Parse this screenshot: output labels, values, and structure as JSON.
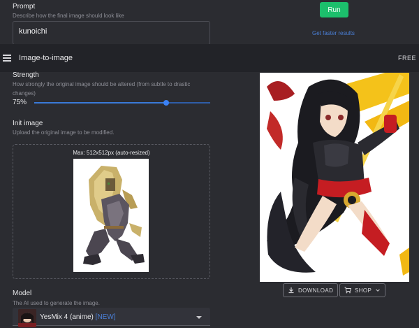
{
  "prompt": {
    "label": "Prompt",
    "description": "Describe how the final image should look like",
    "value": "kunoichi"
  },
  "run_button": {
    "label": "Run"
  },
  "faster_link": "Get faster results",
  "appbar": {
    "title": "Image-to-image",
    "plan": "FREE",
    "menu_icon": "hamburger-menu-icon"
  },
  "strength": {
    "label": "Strength",
    "description": "How strongly the original image should be altered (from subtle to drastic changes)",
    "value_text": "75%",
    "value": 0.75
  },
  "init_image": {
    "label": "Init image",
    "description": "Upload the original image to be modified.",
    "caption": "Max: 512x512px (auto-resized)"
  },
  "model": {
    "label": "Model",
    "description": "The AI used to generate the image.",
    "selected": "YesMix 4 (anime)",
    "badge": "[NEW]"
  },
  "actions": {
    "download_label": "DOWNLOAD",
    "download_icon": "download-icon",
    "shop_label": "SHOP",
    "shop_icon": "cart-icon"
  },
  "colors": {
    "background": "#2b2c31",
    "appbar": "#222328",
    "run_button": "#1cbf6c",
    "accent_blue": "#3b82f6",
    "link": "#4a7fd6"
  }
}
